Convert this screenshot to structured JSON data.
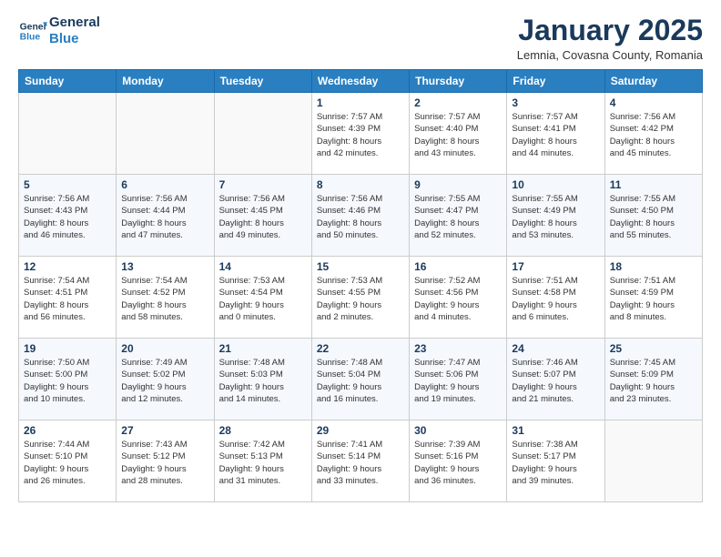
{
  "header": {
    "logo_line1": "General",
    "logo_line2": "Blue",
    "month": "January 2025",
    "location": "Lemnia, Covasna County, Romania"
  },
  "weekdays": [
    "Sunday",
    "Monday",
    "Tuesday",
    "Wednesday",
    "Thursday",
    "Friday",
    "Saturday"
  ],
  "weeks": [
    [
      {
        "day": "",
        "info": ""
      },
      {
        "day": "",
        "info": ""
      },
      {
        "day": "",
        "info": ""
      },
      {
        "day": "1",
        "info": "Sunrise: 7:57 AM\nSunset: 4:39 PM\nDaylight: 8 hours\nand 42 minutes."
      },
      {
        "day": "2",
        "info": "Sunrise: 7:57 AM\nSunset: 4:40 PM\nDaylight: 8 hours\nand 43 minutes."
      },
      {
        "day": "3",
        "info": "Sunrise: 7:57 AM\nSunset: 4:41 PM\nDaylight: 8 hours\nand 44 minutes."
      },
      {
        "day": "4",
        "info": "Sunrise: 7:56 AM\nSunset: 4:42 PM\nDaylight: 8 hours\nand 45 minutes."
      }
    ],
    [
      {
        "day": "5",
        "info": "Sunrise: 7:56 AM\nSunset: 4:43 PM\nDaylight: 8 hours\nand 46 minutes."
      },
      {
        "day": "6",
        "info": "Sunrise: 7:56 AM\nSunset: 4:44 PM\nDaylight: 8 hours\nand 47 minutes."
      },
      {
        "day": "7",
        "info": "Sunrise: 7:56 AM\nSunset: 4:45 PM\nDaylight: 8 hours\nand 49 minutes."
      },
      {
        "day": "8",
        "info": "Sunrise: 7:56 AM\nSunset: 4:46 PM\nDaylight: 8 hours\nand 50 minutes."
      },
      {
        "day": "9",
        "info": "Sunrise: 7:55 AM\nSunset: 4:47 PM\nDaylight: 8 hours\nand 52 minutes."
      },
      {
        "day": "10",
        "info": "Sunrise: 7:55 AM\nSunset: 4:49 PM\nDaylight: 8 hours\nand 53 minutes."
      },
      {
        "day": "11",
        "info": "Sunrise: 7:55 AM\nSunset: 4:50 PM\nDaylight: 8 hours\nand 55 minutes."
      }
    ],
    [
      {
        "day": "12",
        "info": "Sunrise: 7:54 AM\nSunset: 4:51 PM\nDaylight: 8 hours\nand 56 minutes."
      },
      {
        "day": "13",
        "info": "Sunrise: 7:54 AM\nSunset: 4:52 PM\nDaylight: 8 hours\nand 58 minutes."
      },
      {
        "day": "14",
        "info": "Sunrise: 7:53 AM\nSunset: 4:54 PM\nDaylight: 9 hours\nand 0 minutes."
      },
      {
        "day": "15",
        "info": "Sunrise: 7:53 AM\nSunset: 4:55 PM\nDaylight: 9 hours\nand 2 minutes."
      },
      {
        "day": "16",
        "info": "Sunrise: 7:52 AM\nSunset: 4:56 PM\nDaylight: 9 hours\nand 4 minutes."
      },
      {
        "day": "17",
        "info": "Sunrise: 7:51 AM\nSunset: 4:58 PM\nDaylight: 9 hours\nand 6 minutes."
      },
      {
        "day": "18",
        "info": "Sunrise: 7:51 AM\nSunset: 4:59 PM\nDaylight: 9 hours\nand 8 minutes."
      }
    ],
    [
      {
        "day": "19",
        "info": "Sunrise: 7:50 AM\nSunset: 5:00 PM\nDaylight: 9 hours\nand 10 minutes."
      },
      {
        "day": "20",
        "info": "Sunrise: 7:49 AM\nSunset: 5:02 PM\nDaylight: 9 hours\nand 12 minutes."
      },
      {
        "day": "21",
        "info": "Sunrise: 7:48 AM\nSunset: 5:03 PM\nDaylight: 9 hours\nand 14 minutes."
      },
      {
        "day": "22",
        "info": "Sunrise: 7:48 AM\nSunset: 5:04 PM\nDaylight: 9 hours\nand 16 minutes."
      },
      {
        "day": "23",
        "info": "Sunrise: 7:47 AM\nSunset: 5:06 PM\nDaylight: 9 hours\nand 19 minutes."
      },
      {
        "day": "24",
        "info": "Sunrise: 7:46 AM\nSunset: 5:07 PM\nDaylight: 9 hours\nand 21 minutes."
      },
      {
        "day": "25",
        "info": "Sunrise: 7:45 AM\nSunset: 5:09 PM\nDaylight: 9 hours\nand 23 minutes."
      }
    ],
    [
      {
        "day": "26",
        "info": "Sunrise: 7:44 AM\nSunset: 5:10 PM\nDaylight: 9 hours\nand 26 minutes."
      },
      {
        "day": "27",
        "info": "Sunrise: 7:43 AM\nSunset: 5:12 PM\nDaylight: 9 hours\nand 28 minutes."
      },
      {
        "day": "28",
        "info": "Sunrise: 7:42 AM\nSunset: 5:13 PM\nDaylight: 9 hours\nand 31 minutes."
      },
      {
        "day": "29",
        "info": "Sunrise: 7:41 AM\nSunset: 5:14 PM\nDaylight: 9 hours\nand 33 minutes."
      },
      {
        "day": "30",
        "info": "Sunrise: 7:39 AM\nSunset: 5:16 PM\nDaylight: 9 hours\nand 36 minutes."
      },
      {
        "day": "31",
        "info": "Sunrise: 7:38 AM\nSunset: 5:17 PM\nDaylight: 9 hours\nand 39 minutes."
      },
      {
        "day": "",
        "info": ""
      }
    ]
  ]
}
